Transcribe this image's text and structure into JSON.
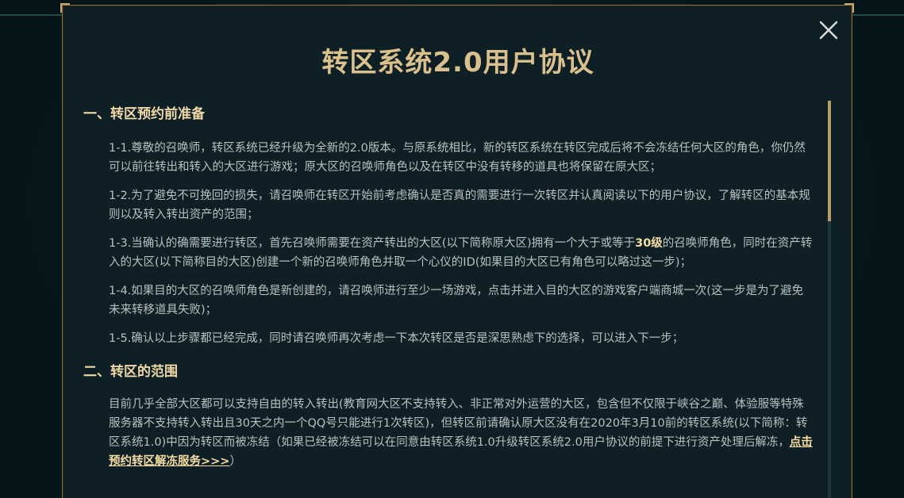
{
  "dialog": {
    "title": "转区系统2.0用户协议",
    "close_icon": "close-icon"
  },
  "sections": [
    {
      "heading": "一、转区预约前准备",
      "paragraphs": [
        "1-1.尊敬的召唤师，转区系统已经升级为全新的2.0版本。与原系统相比，新的转区系统在转区完成后将不会冻结任何大区的角色，你仍然可以前往转出和转入的大区进行游戏；原大区的召唤师角色以及在转区中没有转移的道具也将保留在原大区；",
        "1-2.为了避免不可挽回的损失，请召唤师在转区开始前考虑确认是否真的需要进行一次转区并认真阅读以下的用户协议，了解转区的基本规则以及转入转出资产的范围；",
        "1-4.如果目的大区的召唤师角色是新创建的，请召唤师进行至少一场游戏，点击并进入目的大区的游戏客户端商城一次(这一步是为了避免未来转移道具失败)；",
        "1-5.确认以上步骤都已经完成，同时请召唤师再次考虑一下本次转区是否是深思熟虑下的选择，可以进入下一步；"
      ],
      "p3": {
        "before": "1-3.当确认的确需要进行转区，首先召唤师需要在资产转出的大区(以下简称原大区)拥有一个大于或等于",
        "highlight": "30级",
        "after": "的召唤师角色，同时在资产转入的大区(以下简称目的大区)创建一个新的召唤师角色并取一个心仪的ID(如果目的大区已有角色可以略过这一步)；"
      }
    },
    {
      "heading": "二、转区的范围",
      "p1": {
        "before": "目前几乎全部大区都可以支持自由的转入转出(教育网大区不支持转入、非正常对外运营的大区，包含但不仅限于峡谷之巅、体验服等特殊服务器不支持转入转出且30天之内一个QQ号只能进行1次转区)，但转区前请确认原大区没有在2020年3月10前的转区系统(以下简称：转区系统1.0)中因为转区而被冻结（如果已经被冻结可以在同意由转区系统1.0升级转区系统2.0用户协议的前提下进行资产处理后解冻，",
        "link": "点击预约转区解冻服务>>>",
        "after": "）"
      }
    }
  ],
  "colors": {
    "title": "#d9c08c",
    "heading": "#f0d9a7",
    "body_text": "#b7c2c0",
    "highlight": "#f6dba2",
    "border": "#8a7547",
    "panel_bg": "#0e1f26"
  }
}
